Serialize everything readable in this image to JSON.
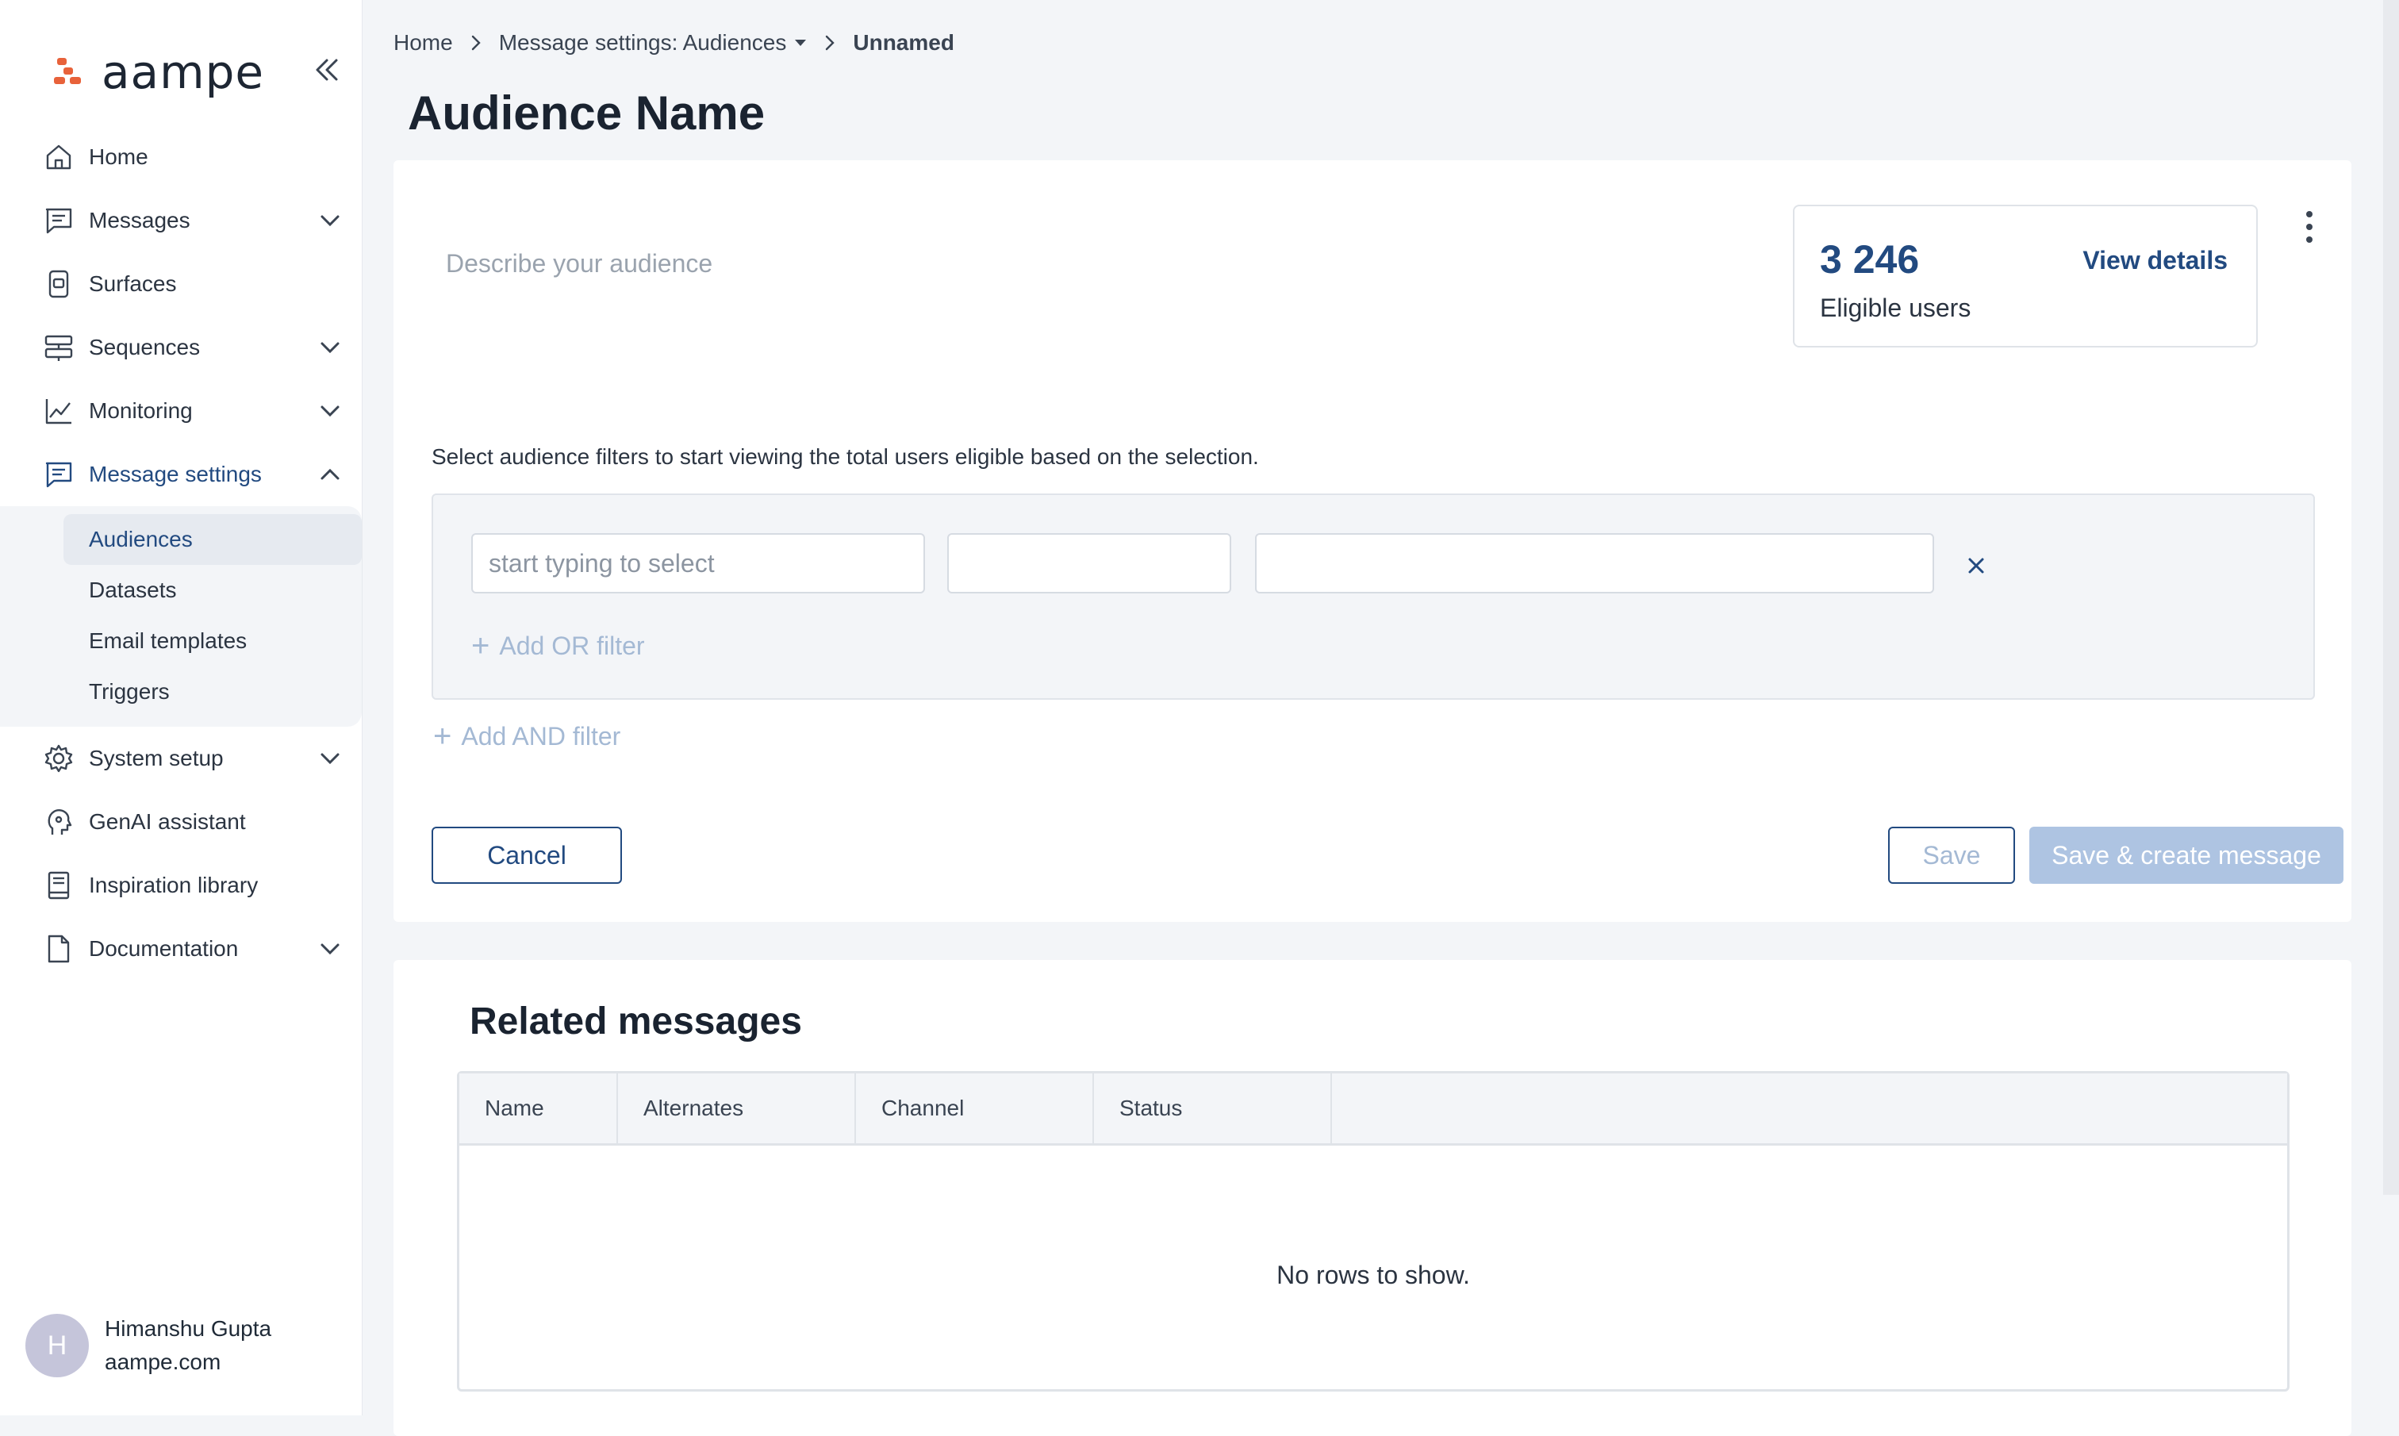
{
  "brand": {
    "name": "aampe",
    "accent": "#e8623a",
    "primary": "#224a80"
  },
  "sidebar": {
    "collapse_icon": "double-chevron-left-icon",
    "items": [
      {
        "label": "Home",
        "icon": "home-icon"
      },
      {
        "label": "Messages",
        "icon": "message-icon",
        "expandable": true
      },
      {
        "label": "Surfaces",
        "icon": "phone-icon"
      },
      {
        "label": "Sequences",
        "icon": "sequence-icon",
        "expandable": true
      },
      {
        "label": "Monitoring",
        "icon": "chart-line-icon",
        "expandable": true
      },
      {
        "label": "Message settings",
        "icon": "message-settings-icon",
        "expanded": true
      },
      {
        "label": "System setup",
        "icon": "gear-icon",
        "expandable": true
      },
      {
        "label": "GenAI assistant",
        "icon": "ai-head-icon"
      },
      {
        "label": "Inspiration library",
        "icon": "book-icon"
      },
      {
        "label": "Documentation",
        "icon": "document-icon",
        "expandable": true
      }
    ],
    "subitems": [
      "Audiences",
      "Datasets",
      "Email templates",
      "Triggers"
    ],
    "active_subitem": "Audiences"
  },
  "user": {
    "initial": "H",
    "name": "Himanshu Gupta",
    "org": "aampe.com"
  },
  "breadcrumb": {
    "home": "Home",
    "parent": "Message settings: Audiences",
    "current": "Unnamed"
  },
  "page": {
    "title": "Audience Name"
  },
  "audience": {
    "description_placeholder": "Describe your audience",
    "eligible_count": "3 246",
    "eligible_label": "Eligible users",
    "view_details": "View details",
    "hint": "Select audience filters to start viewing the total users eligible based on the selection.",
    "filter": {
      "field_placeholder": "start typing to select",
      "operator_value": "",
      "value_value": ""
    },
    "add_or": "Add OR filter",
    "add_and": "Add AND filter",
    "buttons": {
      "cancel": "Cancel",
      "save": "Save",
      "save_create": "Save & create message"
    }
  },
  "related": {
    "title": "Related messages",
    "columns": [
      "Name",
      "Alternates",
      "Channel",
      "Status"
    ],
    "empty": "No rows to show."
  }
}
